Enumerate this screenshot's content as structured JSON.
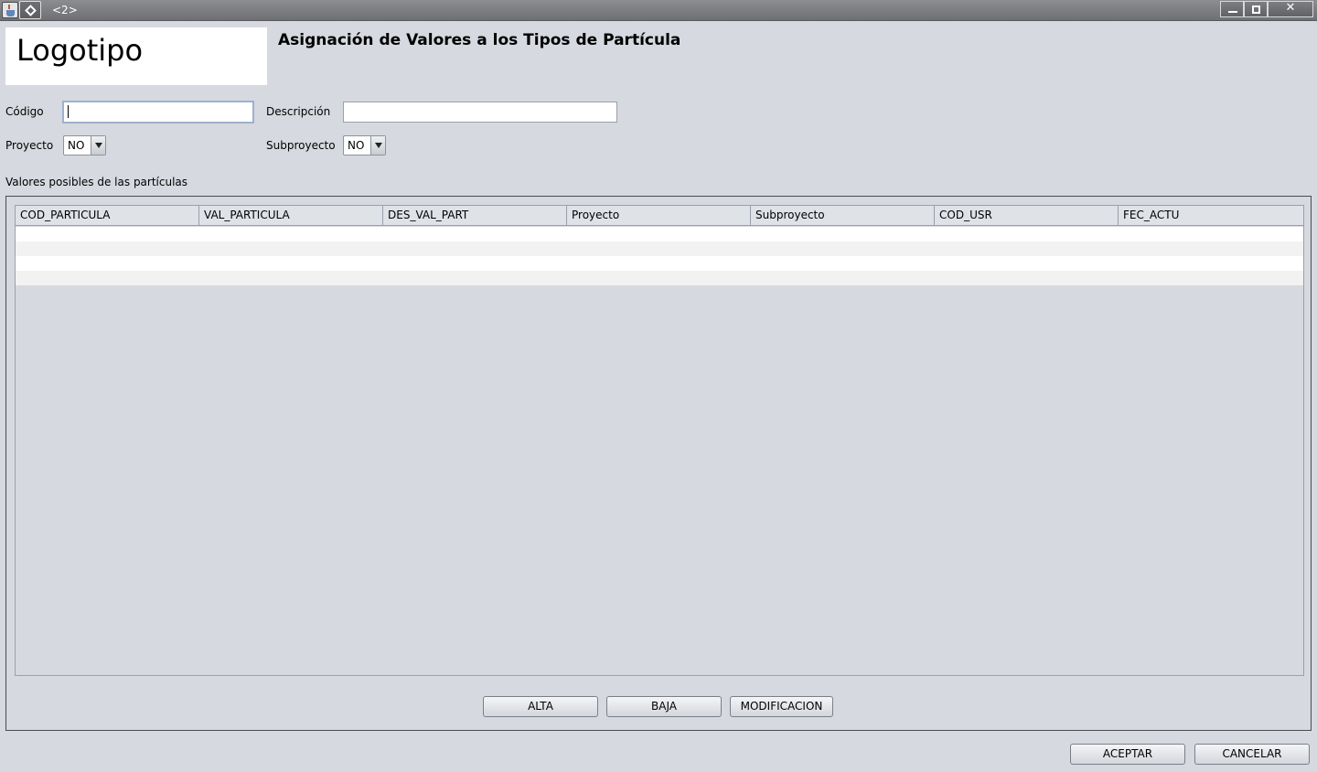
{
  "window": {
    "title": "<2>"
  },
  "header": {
    "logo_text": "Logotipo",
    "title": "Asignación de Valores a los Tipos de Partícula"
  },
  "form": {
    "codigo_label": "Código",
    "codigo_value": "",
    "descripcion_label": "Descripción",
    "descripcion_value": "",
    "proyecto_label": "Proyecto",
    "proyecto_value": "NO",
    "subproyecto_label": "Subproyecto",
    "subproyecto_value": "NO"
  },
  "table": {
    "caption": "Valores posibles de las partículas",
    "columns": [
      "COD_PARTICULA",
      "VAL_PARTICULA",
      "DES_VAL_PART",
      "Proyecto",
      "Subproyecto",
      "COD_USR",
      "FEC_ACTU"
    ],
    "rows": []
  },
  "panel_buttons": {
    "alta": "ALTA",
    "baja": "BAJA",
    "modificacion": "MODIFICACION"
  },
  "dialog_buttons": {
    "aceptar": "ACEPTAR",
    "cancelar": "CANCELAR"
  }
}
